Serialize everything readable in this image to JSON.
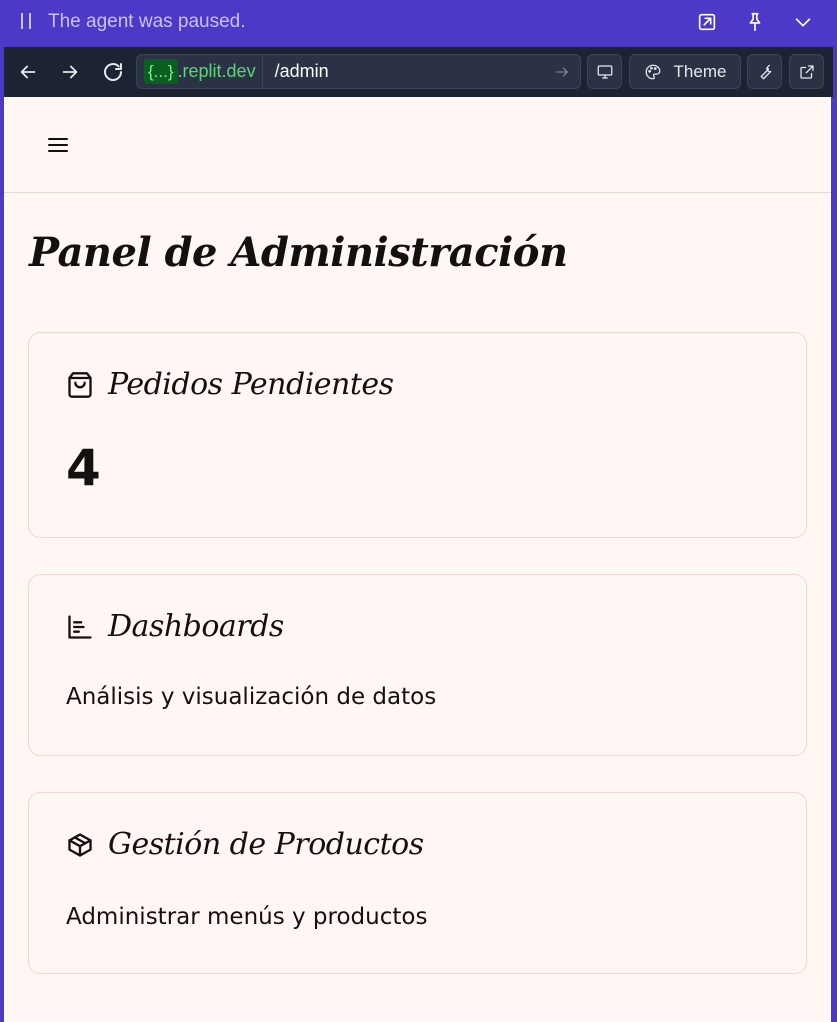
{
  "agent_bar": {
    "status": "The agent was paused.",
    "icons": [
      "pause-icon",
      "open-in-new-icon",
      "pin-icon",
      "chevron-down-icon"
    ]
  },
  "browser": {
    "domain_highlight": "{...}",
    "domain_rest": ".replit.dev",
    "path": "/admin",
    "theme_label": "Theme"
  },
  "page": {
    "title": "Panel de Administración",
    "cards": [
      {
        "title": "Pedidos Pendientes",
        "icon": "shopping-bag-icon",
        "value": "4"
      },
      {
        "title": "Dashboards",
        "icon": "bar-chart-icon",
        "description": "Análisis y visualización de datos"
      },
      {
        "title": "Gestión de Productos",
        "icon": "package-icon",
        "description": "Administrar menús y productos"
      }
    ]
  },
  "colors": {
    "agent_bar_bg": "#4d39c8",
    "browser_bar_bg": "#1c2333",
    "page_bg": "#fff7f3",
    "card_border": "#f0d8ce",
    "domain_highlight": "#0a5e1f"
  }
}
